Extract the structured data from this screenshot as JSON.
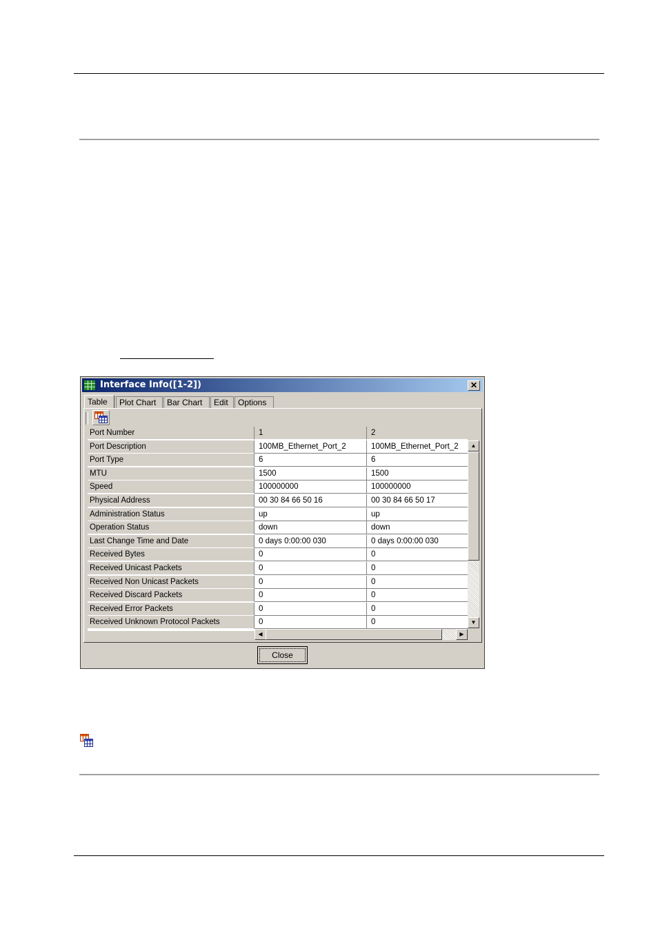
{
  "window": {
    "title": "Interface Info([1-2])",
    "close_glyph": "✕"
  },
  "tabs": [
    {
      "label": "Table",
      "active": true
    },
    {
      "label": "Plot Chart"
    },
    {
      "label": "Bar Chart"
    },
    {
      "label": "Edit"
    },
    {
      "label": "Options"
    }
  ],
  "toolbar": {
    "table_icon": "table-icon"
  },
  "table": {
    "header": {
      "label": "Port Number",
      "col1": "1",
      "col2": "2"
    },
    "rows": [
      {
        "label": "Port Description",
        "v1": "100MB_Ethernet_Port_2",
        "v2": "100MB_Ethernet_Port_2"
      },
      {
        "label": "Port Type",
        "v1": "6",
        "v2": "6"
      },
      {
        "label": "MTU",
        "v1": "1500",
        "v2": "1500"
      },
      {
        "label": "Speed",
        "v1": "100000000",
        "v2": "100000000"
      },
      {
        "label": "Physical Address",
        "v1": "00 30 84 66 50 16",
        "v2": "00 30 84 66 50 17"
      },
      {
        "label": "Administration Status",
        "v1": "up",
        "v2": "up"
      },
      {
        "label": "Operation Status",
        "v1": "down",
        "v2": "down"
      },
      {
        "label": "Last Change Time and Date",
        "v1": "0 days 0:00:00 030",
        "v2": "0 days 0:00:00 030"
      },
      {
        "label": "Received Bytes",
        "v1": "0",
        "v2": "0"
      },
      {
        "label": "Received Unicast Packets",
        "v1": "0",
        "v2": "0"
      },
      {
        "label": "Received Non Unicast Packets",
        "v1": "0",
        "v2": "0"
      },
      {
        "label": "Received Discard Packets",
        "v1": "0",
        "v2": "0"
      },
      {
        "label": "Received Error Packets",
        "v1": "0",
        "v2": "0"
      },
      {
        "label": "Received Unknown Protocol Packets",
        "v1": "0",
        "v2": "0"
      }
    ]
  },
  "buttons": {
    "close": "Close"
  },
  "scroll_arrows": {
    "up": "▲",
    "down": "▼",
    "left": "◀",
    "right": "▶"
  }
}
